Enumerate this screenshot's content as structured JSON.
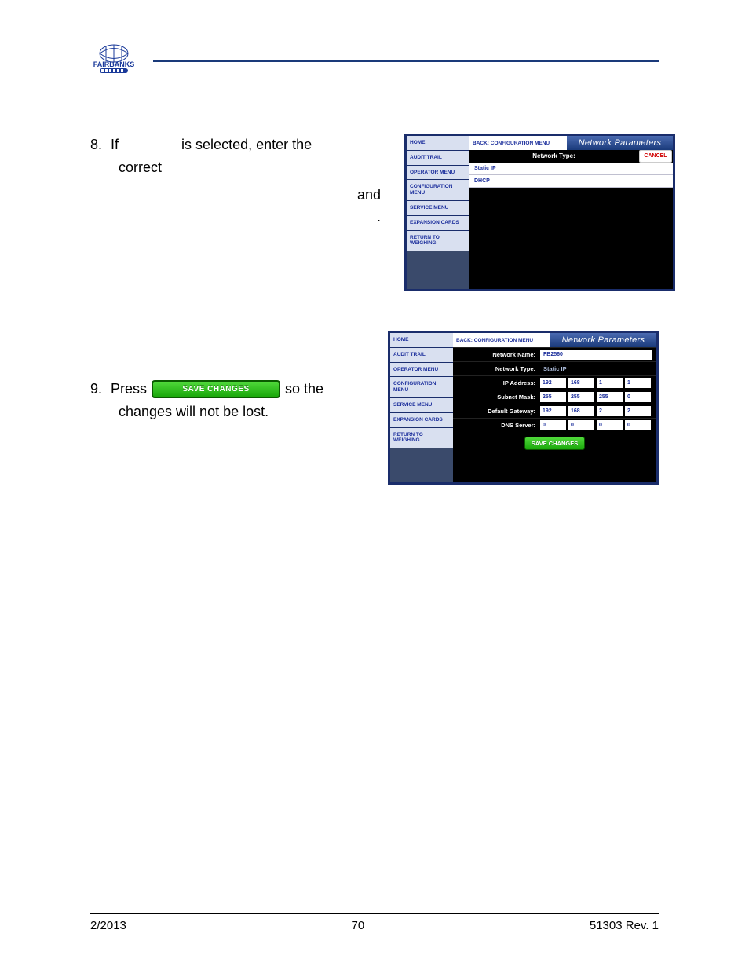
{
  "header": {
    "brand": "FAIRBANKS"
  },
  "step8": {
    "number": "8.",
    "t1": "If",
    "t2": "is selected, enter the",
    "t3": "correct",
    "t4": "and",
    "t5": "."
  },
  "step9": {
    "number": "9.",
    "t1": "Press",
    "btn": "SAVE CHANGES",
    "t2": "so the",
    "t3": "changes will not be lost."
  },
  "sidebar": {
    "items": [
      "HOME",
      "AUDIT TRAIL",
      "OPERATOR MENU",
      "CONFIGURATION MENU",
      "SERVICE MENU",
      "EXPANSION CARDS",
      "RETURN TO WEIGHING"
    ]
  },
  "shot1": {
    "back": "BACK: CONFIGURATION MENU",
    "title": "Network Parameters",
    "subtitle": "Network Type:",
    "cancel": "CANCEL",
    "opt1": "Static IP",
    "opt2": "DHCP"
  },
  "shot2": {
    "back": "BACK: CONFIGURATION MENU",
    "title": "Network Parameters",
    "rows": {
      "name_label": "Network Name:",
      "name_val": "FB2560",
      "type_label": "Network Type:",
      "type_val": "Static IP",
      "ip_label": "IP Address:",
      "ip": [
        "192",
        "168",
        "1",
        "1"
      ],
      "mask_label": "Subnet Mask:",
      "mask": [
        "255",
        "255",
        "255",
        "0"
      ],
      "gw_label": "Default Gateway:",
      "gw": [
        "192",
        "168",
        "2",
        "2"
      ],
      "dns_label": "DNS Server:",
      "dns": [
        "0",
        "0",
        "0",
        "0"
      ]
    },
    "save": "SAVE CHANGES"
  },
  "footer": {
    "left": "2/2013",
    "center": "70",
    "right": "51303     Rev. 1"
  }
}
